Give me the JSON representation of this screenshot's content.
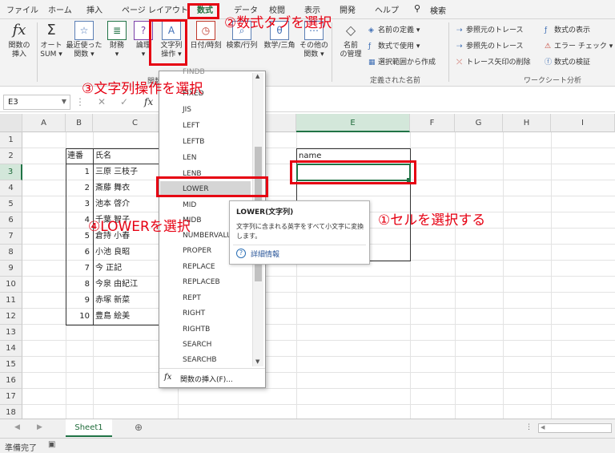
{
  "menu": {
    "tabs": [
      "ファイル",
      "ホーム",
      "挿入",
      "ページ レイアウト",
      "数式",
      "データ",
      "校閲",
      "表示",
      "開発",
      "ヘルプ"
    ],
    "active_tab": "数式",
    "search_icon": "search-icon",
    "search_label": "検索"
  },
  "ribbon": {
    "insert_function": {
      "icon": "fx-icon",
      "label1": "関数の",
      "label2": "挿入"
    },
    "autosum": {
      "icon": "sigma-icon",
      "label1": "オート",
      "label2": "SUM ▾"
    },
    "recent": {
      "icon": "star-icon",
      "label1": "最近使った",
      "label2": "関数 ▾"
    },
    "financial": {
      "icon": "database-icon",
      "label1": "財務",
      "label2": "▾"
    },
    "logical": {
      "icon": "question-book-icon",
      "label1": "論理",
      "label2": "▾"
    },
    "text": {
      "icon": "text-a-icon",
      "label1": "文字列",
      "label2": "操作 ▾"
    },
    "datetime": {
      "icon": "clock-icon",
      "label": "日付/時刻"
    },
    "lookup": {
      "icon": "lookup-icon",
      "label": "検索/行列"
    },
    "math": {
      "icon": "math-icon",
      "label": "数学/三角"
    },
    "more": {
      "icon": "more-functions-icon",
      "label1": "その他の",
      "label2": "関数 ▾"
    },
    "name_manager": {
      "icon": "name-tag-icon",
      "label1": "名前",
      "label2": "の管理"
    },
    "define_name": "名前の定義 ▾",
    "use_in_formula": "数式で使用 ▾",
    "create_from_selection": "選択範囲から作成",
    "defined_names_group": "定義された名前",
    "trace_precedents": "参照元のトレース",
    "trace_dependents": "参照先のトレース",
    "remove_arrows": "トレース矢印の削除",
    "show_formulas": "数式の表示",
    "error_check": "エラー チェック ▾",
    "evaluate_formula": "数式の検証",
    "formula_auditing_group": "ワークシート分析",
    "library_group_partial": "関数"
  },
  "formula_bar": {
    "namebox": "E3",
    "cancel": "✕",
    "enter": "✓",
    "fx": "fx"
  },
  "grid": {
    "columns": [
      "A",
      "B",
      "C",
      "D",
      "E",
      "F",
      "G",
      "H",
      "I"
    ],
    "rows": [
      "1",
      "2",
      "3",
      "4",
      "5",
      "6",
      "7",
      "8",
      "9",
      "10",
      "11",
      "12",
      "13",
      "14",
      "15",
      "16",
      "17",
      "18"
    ],
    "header_no": "連番",
    "header_name": "氏名",
    "header_e": "name",
    "records": [
      {
        "no": "1",
        "name": "三原 三枝子"
      },
      {
        "no": "2",
        "name": "斎藤 舞衣"
      },
      {
        "no": "3",
        "name": "池本 啓介"
      },
      {
        "no": "4",
        "name": "千葉 智子"
      },
      {
        "no": "5",
        "name": "倉持 小春"
      },
      {
        "no": "6",
        "name": "小池 良昭"
      },
      {
        "no": "7",
        "name": "今 正記"
      },
      {
        "no": "8",
        "name": "今泉 由紀江"
      },
      {
        "no": "9",
        "name": "赤塚 新菜"
      },
      {
        "no": "10",
        "name": "豊島 絵美"
      }
    ]
  },
  "dropdown": {
    "items": [
      "FINDB",
      "FIXED",
      "JIS",
      "LEFT",
      "LEFTB",
      "LEN",
      "LENB",
      "LOWER",
      "MID",
      "MIDB",
      "NUMBERVALUE",
      "PROPER",
      "REPLACE",
      "REPLACEB",
      "REPT",
      "RIGHT",
      "RIGHTB",
      "SEARCH",
      "SEARCHB"
    ],
    "highlighted": "LOWER",
    "footer_icon": "fx-icon",
    "footer_label": "関数の挿入(F)..."
  },
  "tooltip": {
    "title": "LOWER(文字列)",
    "description": "文字列に含まれる英字をすべて小文字に変換します。",
    "help_icon": "help-circle-icon",
    "help_link": "詳細情報"
  },
  "annotations": {
    "step1": "①セルを選択する",
    "step2": "②数式タブを選択",
    "step3": "③文字列操作を選択",
    "step4": "④LOWERを選択"
  },
  "sheet_tabs": {
    "active": "Sheet1",
    "add_icon": "plus-circle-icon"
  },
  "status": {
    "text": "準備完了",
    "icon": "macro-record-icon"
  },
  "colors": {
    "accent": "#217346",
    "annotation": "#e60012",
    "link": "#2b579a"
  }
}
